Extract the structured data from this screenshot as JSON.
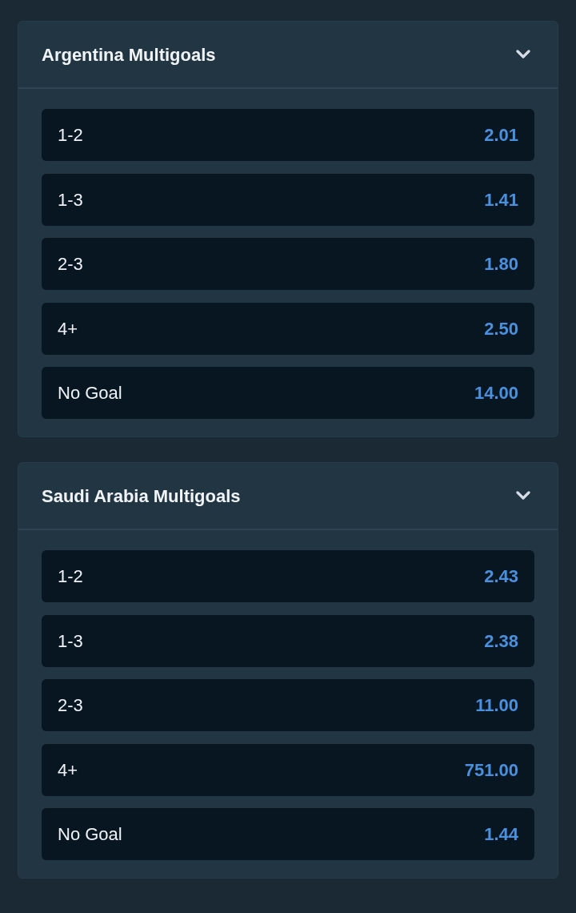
{
  "markets": [
    {
      "title": "Argentina Multigoals",
      "expanded": true,
      "selections": [
        {
          "label": "1-2",
          "odds": "2.01"
        },
        {
          "label": "1-3",
          "odds": "1.41"
        },
        {
          "label": "2-3",
          "odds": "1.80"
        },
        {
          "label": "4+",
          "odds": "2.50"
        },
        {
          "label": "No Goal",
          "odds": "14.00"
        }
      ]
    },
    {
      "title": "Saudi Arabia Multigoals",
      "expanded": true,
      "selections": [
        {
          "label": "1-2",
          "odds": "2.43"
        },
        {
          "label": "1-3",
          "odds": "2.38"
        },
        {
          "label": "2-3",
          "odds": "11.00"
        },
        {
          "label": "4+",
          "odds": "751.00"
        },
        {
          "label": "No Goal",
          "odds": "1.44"
        }
      ]
    }
  ]
}
